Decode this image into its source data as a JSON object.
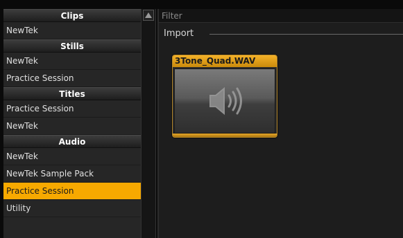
{
  "sidebar": {
    "groups": [
      {
        "header": "Clips",
        "items": [
          "NewTek"
        ]
      },
      {
        "header": "Stills",
        "items": [
          "NewTek",
          "Practice Session"
        ]
      },
      {
        "header": "Titles",
        "items": [
          "Practice Session",
          "NewTek"
        ]
      },
      {
        "header": "Audio",
        "items": [
          "NewTek",
          "NewTek Sample Pack",
          "Practice Session",
          "Utility"
        ]
      }
    ],
    "selected": "Audio / Practice Session"
  },
  "filter": {
    "placeholder": "Filter",
    "value": ""
  },
  "section": {
    "title": "Import"
  },
  "clip": {
    "title": "3Tone_Quad.WAV",
    "icon": "speaker-icon"
  },
  "colors": {
    "accent": "#f7a900",
    "panel": "#262626",
    "content": "#1d1d1d"
  }
}
